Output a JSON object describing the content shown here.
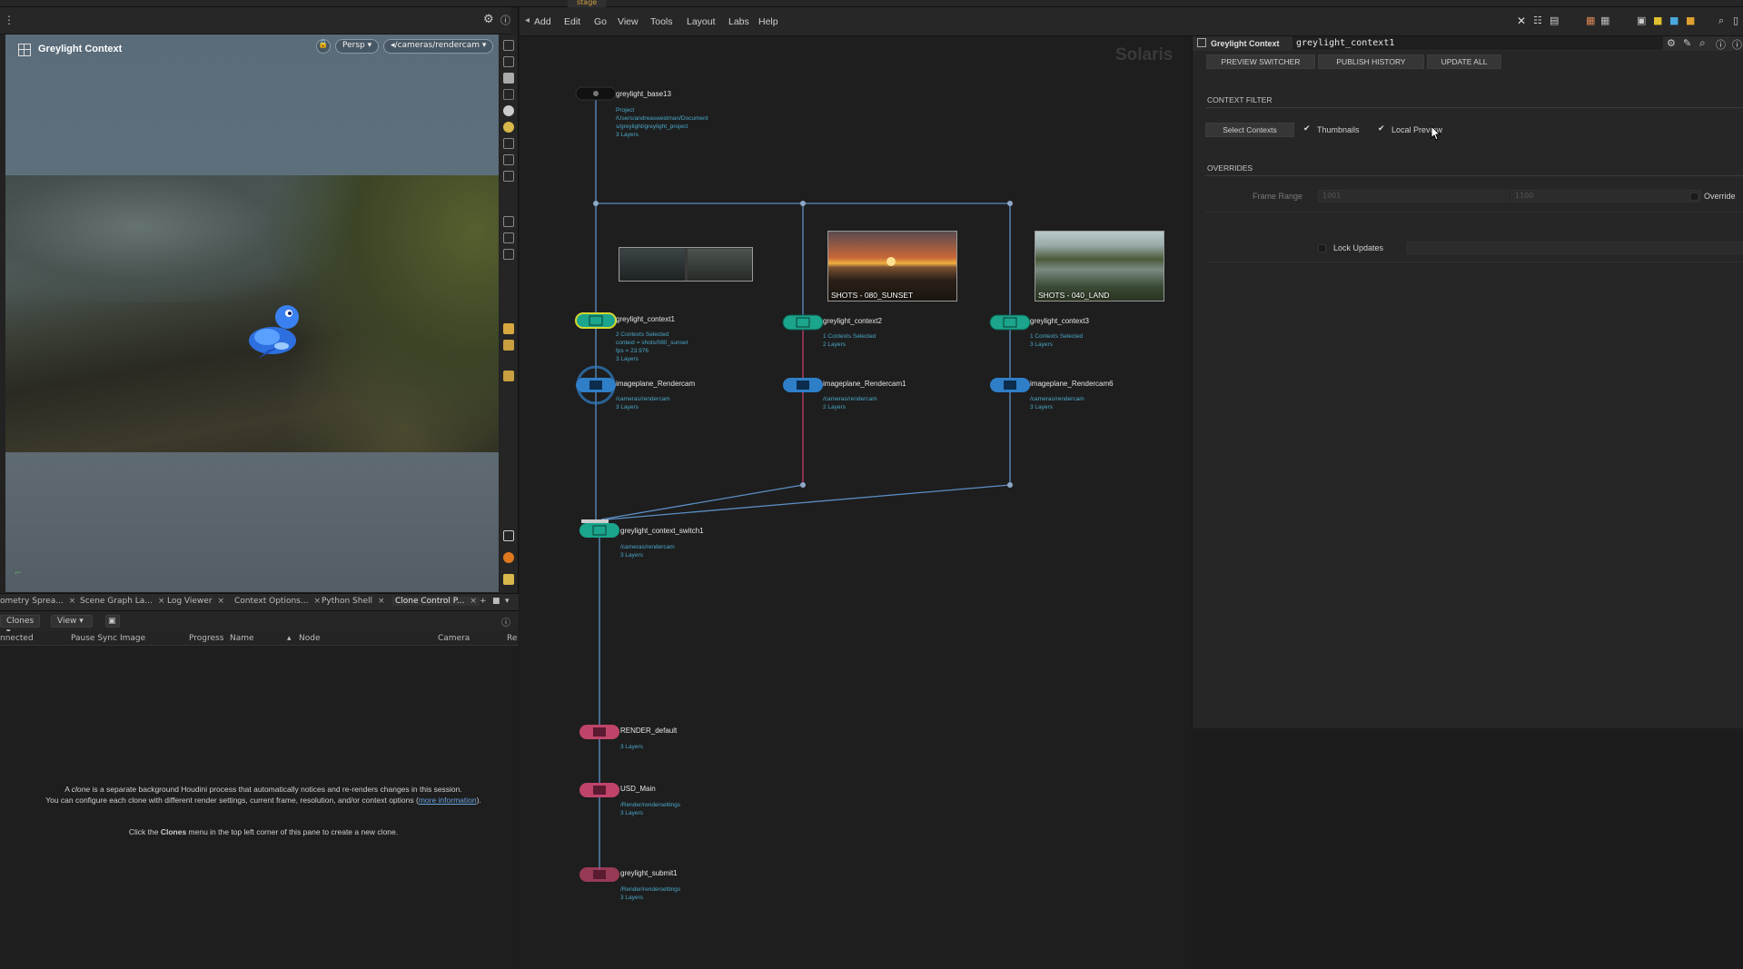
{
  "topbar": {
    "tab_label": "stage"
  },
  "viewport": {
    "title": "Greylight Context",
    "persp_label": "Persp",
    "camera_label": "/cameras/rendercam"
  },
  "pane_tabs": [
    {
      "label": "ometry Sprea..."
    },
    {
      "label": "Scene Graph La..."
    },
    {
      "label": "Log Viewer"
    },
    {
      "label": "Context Options..."
    },
    {
      "label": "Python Shell"
    },
    {
      "label": "Clone Control P..."
    }
  ],
  "clone_toolbar": {
    "clones_label": "Clones",
    "view_label": "View"
  },
  "clone_columns": [
    "nnected",
    "Pause Sync",
    "Image",
    "Progress",
    "Name",
    "Node",
    "Camera",
    "Re"
  ],
  "clone_help": {
    "line1_a": "A ",
    "line1_clone": "clone",
    "line1_b": " is a separate background Houdini process that automatically notices and re-renders changes in this session.",
    "line2": "You can configure each clone with different render settings, current frame, resolution, and/or context options (",
    "link": "more information",
    "line2_end": ").",
    "line3_a": "Click the ",
    "line3_clones": "Clones",
    "line3_b": " menu in the top left corner of this pane to create a new clone."
  },
  "menubar": {
    "items": [
      "Add",
      "Edit",
      "Go",
      "View",
      "Tools",
      "Layout",
      "Labs",
      "Help"
    ]
  },
  "network": {
    "context_label": "Solaris",
    "nodes": {
      "base": {
        "name": "greylight_base13",
        "sub": [
          "Project",
          "/Users/andreasweidman/Document",
          "s/greylight/greylight_project",
          "3 Layers"
        ]
      },
      "ctx1": {
        "name": "greylight_context1",
        "sub": [
          "2 Contexts Selected",
          "context = shots/080_sunset",
          "fps = 23.976",
          "3 Layers"
        ]
      },
      "ctx2": {
        "name": "greylight_context2",
        "sub": [
          "1 Contexts Selected",
          "2 Layers"
        ]
      },
      "ctx3": {
        "name": "greylight_context3",
        "sub": [
          "1 Contexts Selected",
          "3 Layers"
        ]
      },
      "ip1": {
        "name": "imageplane_Rendercam",
        "sub": [
          "/cameras/rendercam",
          "3 Layers"
        ]
      },
      "ip2": {
        "name": "imageplane_Rendercam1",
        "sub": [
          "/cameras/rendercam",
          "2 Layers"
        ]
      },
      "ip3": {
        "name": "imageplane_Rendercam6",
        "sub": [
          "/cameras/rendercam",
          "3 Layers"
        ]
      },
      "switch": {
        "name": "greylight_context_switch1",
        "sub": [
          "/cameras/rendercam",
          "3 Layers"
        ]
      },
      "render": {
        "name": "RENDER_default",
        "sub": [
          "3 Layers"
        ]
      },
      "usd": {
        "name": "USD_Main",
        "sub": [
          "/Render/rendersettings",
          "3 Layers"
        ]
      },
      "submit": {
        "name": "greylight_submit1",
        "sub": [
          "/Render/rendersettings",
          "3 Layers"
        ]
      }
    },
    "thumbnails": [
      {
        "label": "SHOTS - 080_SUNSET"
      },
      {
        "label": "SHOTS - 040_LAND"
      }
    ]
  },
  "params": {
    "title": "Greylight Context",
    "node_name": "greylight_context1",
    "buttons": [
      "PREVIEW SWITCHER",
      "PUBLISH HISTORY",
      "UPDATE ALL"
    ],
    "context_filter": {
      "section": "CONTEXT FILTER",
      "select_button": "Select Contexts",
      "thumbnails_label": "Thumbnails",
      "thumbnails_checked": true,
      "local_preview_label": "Local Preview",
      "local_preview_checked": true
    },
    "overrides": {
      "section": "OVERRIDES",
      "frame_range_label": "Frame Range",
      "frame_start": "1001",
      "frame_end": "1100",
      "override_label": "Override",
      "lock_updates_label": "Lock Updates"
    }
  },
  "colors": {
    "wire_blue": "#5b8fc4",
    "wire_pink": "#c03c6c",
    "node_teal": "#1aa58c",
    "node_blue": "#2f7fc8",
    "node_pink": "#c0446a",
    "node_yellow": "#d6d630",
    "sub_text": "#4aa8c8"
  }
}
